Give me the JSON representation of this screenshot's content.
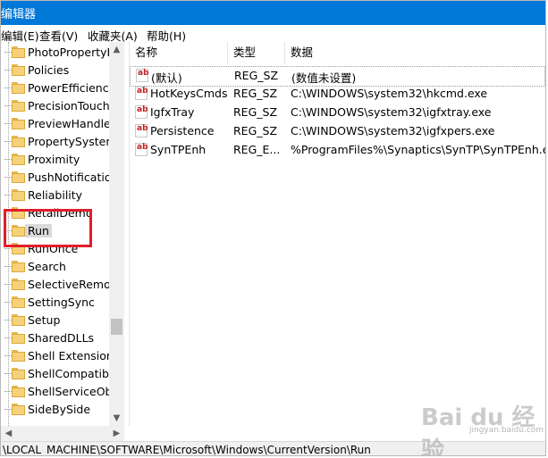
{
  "window": {
    "title": "编辑器"
  },
  "menu": [
    "编辑(E)",
    "查看(V)",
    "收藏夹(A)",
    "帮助(H)"
  ],
  "tree_items": [
    "PhotoPropertyH",
    "Policies",
    "PowerEfficiency",
    "PrecisionTouchP",
    "PreviewHandler",
    "PropertySystem",
    "Proximity",
    "PushNotification",
    "Reliability",
    "RetailDemo",
    "Run",
    "RunOnce",
    "Search",
    "SelectiveRemote",
    "SettingSync",
    "Setup",
    "SharedDLLs",
    "Shell Extensions",
    "ShellCompatibil",
    "ShellServiceObj",
    "SideBySide"
  ],
  "selected_tree_item": "Run",
  "columns": {
    "name": "名称",
    "type": "类型",
    "data": "数据"
  },
  "rows": [
    {
      "name": "(默认)",
      "type": "REG_SZ",
      "data": "(数值未设置)"
    },
    {
      "name": "HotKeysCmds",
      "type": "REG_SZ",
      "data": "C:\\WINDOWS\\system32\\hkcmd.exe"
    },
    {
      "name": "IgfxTray",
      "type": "REG_SZ",
      "data": "C:\\WINDOWS\\system32\\igfxtray.exe"
    },
    {
      "name": "Persistence",
      "type": "REG_SZ",
      "data": "C:\\WINDOWS\\system32\\igfxpers.exe"
    },
    {
      "name": "SynTPEnh",
      "type": "REG_E...",
      "data": "%ProgramFiles%\\Synaptics\\SynTP\\SynTPEnh.exe"
    }
  ],
  "value_icon_glyph": "ab",
  "status_path": "\\LOCAL_MACHINE\\SOFTWARE\\Microsoft\\Windows\\CurrentVersion\\Run",
  "scroll_glyphs": {
    "up": "▲",
    "down": "▼",
    "left": "◀",
    "right": "▶"
  },
  "watermark": {
    "text": "Bai du 经验",
    "sub": "jingyan.baidu.com"
  },
  "colors": {
    "titlebar": "#0078d7",
    "highlight": "#e21e2a",
    "folder": "#f5d27a"
  },
  "icons": {
    "tree_item": "folder-icon",
    "value": "reg-string-icon"
  }
}
